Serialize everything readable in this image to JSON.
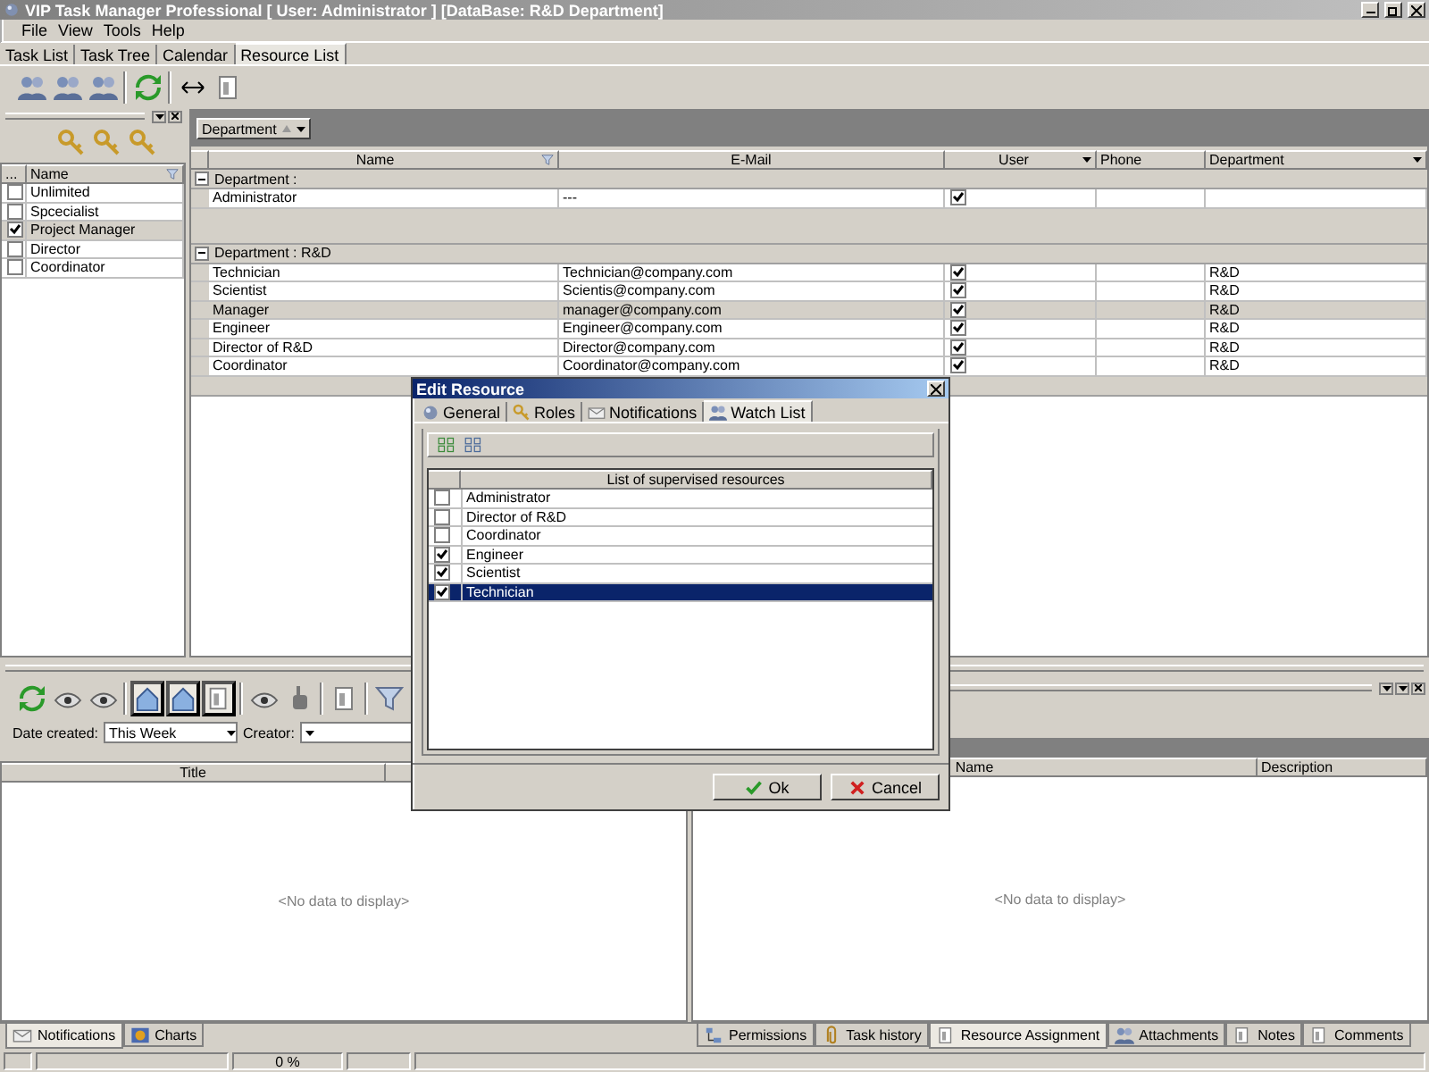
{
  "window": {
    "title": "VIP Task Manager Professional [ User: Administrator ] [DataBase: R&D Department]"
  },
  "menu": [
    {
      "label": "File"
    },
    {
      "label": "View"
    },
    {
      "label": "Tools"
    },
    {
      "label": "Help"
    }
  ],
  "tabs": [
    {
      "label": "Task List",
      "selected": false
    },
    {
      "label": "Task Tree",
      "selected": false
    },
    {
      "label": "Calendar",
      "selected": false
    },
    {
      "label": "Resource List",
      "selected": true
    }
  ],
  "role_list": {
    "columns": [
      "...",
      "Name"
    ],
    "rows": [
      {
        "name": "Unlimited",
        "checked": false,
        "selected": false
      },
      {
        "name": "Spcecialist",
        "checked": false,
        "selected": false
      },
      {
        "name": "Project Manager",
        "checked": true,
        "selected": true
      },
      {
        "name": "Director",
        "checked": false,
        "selected": false
      },
      {
        "name": "Coordinator",
        "checked": false,
        "selected": false
      }
    ]
  },
  "resource_grid": {
    "group_by": "Department",
    "columns": [
      "Name",
      "E-Mail",
      "User",
      "Phone",
      "Department"
    ],
    "groups": [
      {
        "label": "Department :",
        "rows": [
          {
            "name": "Administrator",
            "email": "---",
            "user": true,
            "selected": false
          }
        ]
      },
      {
        "label": "Department : R&D",
        "rows": [
          {
            "name": "Technician",
            "email": "Technician@company.com",
            "user": true,
            "department": "R&D",
            "selected": false
          },
          {
            "name": "Scientist",
            "email": "Scientis@company.com",
            "user": true,
            "department": "R&D",
            "selected": false
          },
          {
            "name": "Manager",
            "email": "manager@company.com",
            "user": true,
            "department": "R&D",
            "selected": true
          },
          {
            "name": "Engineer",
            "email": "Engineer@company.com",
            "user": true,
            "department": "R&D",
            "selected": false
          },
          {
            "name": "Director of R&D",
            "email": "Director@company.com",
            "user": true,
            "department": "R&D",
            "selected": false
          },
          {
            "name": "Coordinator",
            "email": "Coordinator@company.com",
            "user": true,
            "department": "R&D",
            "selected": false
          }
        ]
      }
    ]
  },
  "task_panel": {
    "date_label": "Date created:",
    "date_value": "This Week",
    "creator_label": "Creator:",
    "columns": [
      "Title"
    ],
    "empty_text": "<No data to display>"
  },
  "task_tabs": [
    {
      "label": "Notifications",
      "selected": true
    },
    {
      "label": "Charts",
      "selected": false
    }
  ],
  "detail_panel": {
    "columns": [
      "Name",
      "Description"
    ],
    "empty_text": "<No data to display>"
  },
  "detail_tabs": [
    {
      "label": "Permissions",
      "selected": false
    },
    {
      "label": "Task history",
      "selected": false
    },
    {
      "label": "Resource Assignment",
      "selected": true
    },
    {
      "label": "Attachments",
      "selected": false
    },
    {
      "label": "Notes",
      "selected": false
    },
    {
      "label": "Comments",
      "selected": false
    }
  ],
  "status_bar": {
    "progress": "0 %"
  },
  "dialog": {
    "title": "Edit Resource",
    "tabs": [
      {
        "label": "General",
        "selected": false
      },
      {
        "label": "Roles",
        "selected": false
      },
      {
        "label": "Notifications",
        "selected": false
      },
      {
        "label": "Watch List",
        "selected": true
      }
    ],
    "list_header": "List of supervised resources",
    "rows": [
      {
        "name": "Administrator",
        "checked": false,
        "selected": false
      },
      {
        "name": "Director of R&D",
        "checked": false,
        "selected": false
      },
      {
        "name": "Coordinator",
        "checked": false,
        "selected": false
      },
      {
        "name": "Engineer",
        "checked": true,
        "selected": false
      },
      {
        "name": "Scientist",
        "checked": true,
        "selected": false
      },
      {
        "name": "Technician",
        "checked": true,
        "selected": true
      }
    ],
    "buttons": [
      {
        "label": "Ok",
        "kind": "ok"
      },
      {
        "label": "Cancel",
        "kind": "cancel"
      }
    ]
  }
}
